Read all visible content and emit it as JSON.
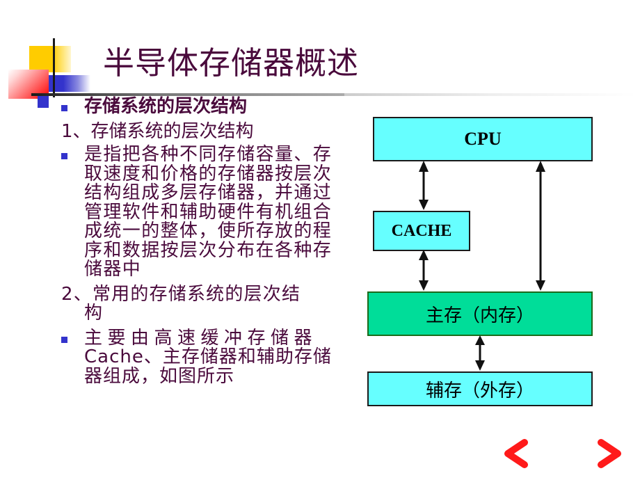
{
  "slide": {
    "title": "半导体存储器概述",
    "content": {
      "bullet1": "存储系统的层次结构",
      "numbered1": "1、存储系统的层次结构",
      "bullet2": "是指把各种不同存储容量、存取速度和价格的存储器按层次结构组成多层存储器，并通过管理软件和辅助硬件有机组合成统一的整体，使所存放的程序和数据按层次分布在各种存储器中",
      "numbered2_line1": "2、常用的存储系统的层次结",
      "numbered2_line2": "构",
      "bullet3_line1": "主要由高速缓冲存储器",
      "bullet3_rest": "Cache、主存储器和辅助存储器组成，如图所示"
    },
    "diagram": {
      "cpu": "CPU",
      "cache": "CACHE",
      "main_memory": "主存（内存）",
      "aux_memory": "辅存（外存）",
      "colors": {
        "cyan_box": "#66ffff",
        "green_box": "#00dd99",
        "bullet": "#3333cc",
        "text": "#4a0a3c"
      }
    },
    "navigation": {
      "prev_icon": "arrow-left-icon",
      "next_icon": "arrow-right-icon"
    }
  }
}
